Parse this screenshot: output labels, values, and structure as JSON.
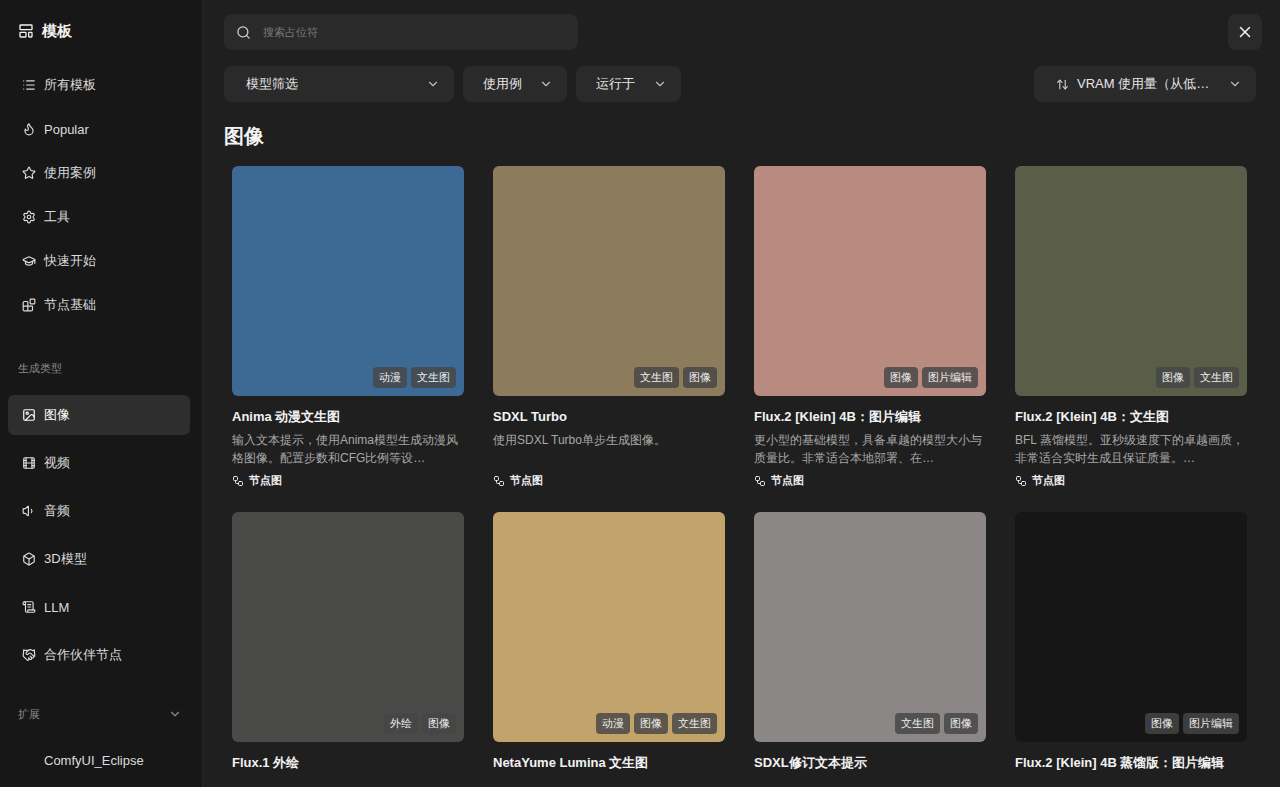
{
  "sidebar": {
    "title": "模板",
    "items": [
      {
        "label": "所有模板",
        "selected": false
      },
      {
        "label": "Popular",
        "selected": false
      },
      {
        "label": "使用案例",
        "selected": false
      },
      {
        "label": "工具",
        "selected": false
      },
      {
        "label": "快速开始",
        "selected": false
      },
      {
        "label": "节点基础",
        "selected": false
      }
    ],
    "sections": [
      {
        "title": "生成类型",
        "collapsible": false,
        "expanded": true,
        "items": [
          {
            "label": "图像",
            "selected": true
          },
          {
            "label": "视频",
            "selected": false
          },
          {
            "label": "音频",
            "selected": false
          },
          {
            "label": "3D模型",
            "selected": false
          },
          {
            "label": "LLM",
            "selected": false
          },
          {
            "label": "合作伙伴节点",
            "selected": false
          }
        ]
      },
      {
        "title": "扩展",
        "collapsible": true,
        "expanded": true,
        "items": [
          {
            "label": "ComfyUI_Eclipse",
            "selected": false
          }
        ]
      }
    ]
  },
  "search": {
    "placeholder": "搜索占位符"
  },
  "filters": [
    "模型筛选",
    "使用例",
    "运行于"
  ],
  "sort": {
    "label": "VRAM 使用量（从低…"
  },
  "section_title": "图像",
  "cards": [
    {
      "title": "Anima 动漫文生图",
      "description": "输入文本提示，使用Anima模型生成动漫风格图像。配置步数和CFG比例等设…",
      "badges": [
        "动漫",
        "文生图"
      ],
      "tag": "节点图",
      "color": "#3d6a94"
    },
    {
      "title": "SDXL Turbo",
      "description": "使用SDXL Turbo单步生成图像。",
      "badges": [
        "文生图",
        "图像"
      ],
      "tag": "节点图",
      "color": "#8c7b5c"
    },
    {
      "title": "Flux.2 [Klein] 4B：图片编辑",
      "description": "更小型的基础模型，具备卓越的模型大小与质量比。非常适合本地部署、在…",
      "badges": [
        "图像",
        "图片编辑"
      ],
      "tag": "节点图",
      "color": "#b88a80"
    },
    {
      "title": "Flux.2 [Klein] 4B：文生图",
      "description": "BFL 蒸馏模型。亚秒级速度下的卓越画质，非常适合实时生成且保证质量。…",
      "badges": [
        "图像",
        "文生图"
      ],
      "tag": "节点图",
      "color": "#5a5d48"
    },
    {
      "title": "Flux.1 外绘",
      "description": "",
      "badges": [
        "外绘",
        "图像"
      ],
      "tag": "",
      "color": "#4a4a48"
    },
    {
      "title": "NetaYume Lumina 文生图",
      "description": "",
      "badges": [
        "动漫",
        "图像",
        "文生图"
      ],
      "tag": "",
      "color": "#c2a36c"
    },
    {
      "title": "SDXL修订文本提示",
      "description": "",
      "badges": [
        "文生图",
        "图像"
      ],
      "tag": "",
      "color": "#8a8786"
    },
    {
      "title": "Flux.2 [Klein] 4B 蒸馏版：图片编辑",
      "description": "",
      "badges": [
        "图像",
        "图片编辑"
      ],
      "tag": "",
      "color": "#161616"
    }
  ]
}
